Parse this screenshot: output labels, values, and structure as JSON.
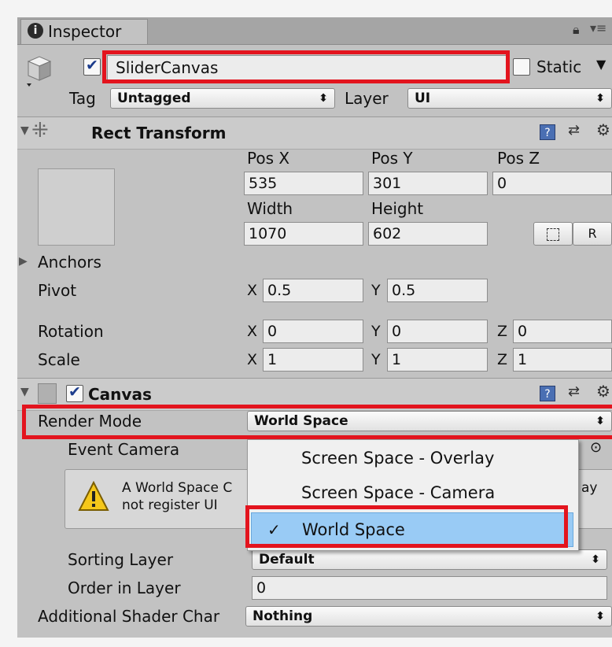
{
  "tab": {
    "label": "Inspector"
  },
  "object": {
    "name": "SliderCanvas",
    "static_label": "Static",
    "static_checked": false,
    "active": true,
    "tag_label": "Tag",
    "tag_value": "Untagged",
    "layer_label": "Layer",
    "layer_value": "UI"
  },
  "rect_transform": {
    "title": "Rect Transform",
    "pos_x_label": "Pos X",
    "pos_y_label": "Pos Y",
    "pos_z_label": "Pos Z",
    "pos_x": "535",
    "pos_y": "301",
    "pos_z": "0",
    "width_label": "Width",
    "height_label": "Height",
    "width": "1070",
    "height": "602",
    "r_button": "R",
    "anchors_label": "Anchors",
    "pivot_label": "Pivot",
    "pivot_x": "0.5",
    "pivot_y": "0.5",
    "rotation_label": "Rotation",
    "rot_x": "0",
    "rot_y": "0",
    "rot_z": "0",
    "scale_label": "Scale",
    "scale_x": "1",
    "scale_y": "1",
    "scale_z": "1",
    "x": "X",
    "y": "Y",
    "z": "Z"
  },
  "canvas": {
    "title": "Canvas",
    "enabled": true,
    "render_mode_label": "Render Mode",
    "render_mode_value": "World Space",
    "event_camera_label": "Event Camera",
    "warning_line1": "A World Space C",
    "warning_line2": "not register UI",
    "warning_tail": "ay",
    "sorting_layer_label": "Sorting Layer",
    "sorting_layer_value": "Default",
    "order_label": "Order in Layer",
    "order_value": "0",
    "shader_label": "Additional Shader Char",
    "shader_value": "Nothing"
  },
  "dropdown": {
    "options": [
      "Screen Space - Overlay",
      "Screen Space - Camera",
      "World Space"
    ],
    "selected": "World Space",
    "check": "✓"
  },
  "colors": {
    "highlight": "#e3141e",
    "selection": "#99cbf5",
    "panel": "#c2c2c2"
  }
}
